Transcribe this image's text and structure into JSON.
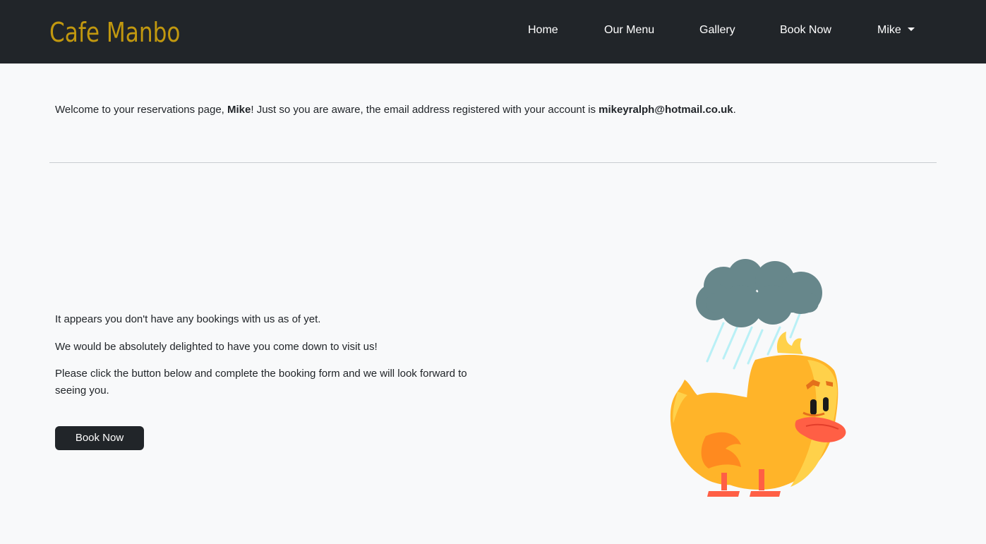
{
  "navbar": {
    "brand": "Cafe Manbo",
    "links": [
      "Home",
      "Our Menu",
      "Gallery",
      "Book Now"
    ],
    "user_menu": "Mike"
  },
  "welcome": {
    "prefix": "Welcome to your reservations page, ",
    "username": "Mike",
    "middle": "! Just so you are aware, the email address registered with your account is ",
    "email": "mikeyralph@hotmail.co.uk",
    "suffix": "."
  },
  "empty_state": {
    "line1": "It appears you don't have any bookings with us as of yet.",
    "line2": "We would be absolutely delighted to have you come down to visit us!",
    "line3": "Please click the button below and complete the booking form and we will look forward to seeing you.",
    "button_label": "Book Now",
    "illustration": "sad-duck-rain-cloud-icon"
  },
  "colors": {
    "navbar_bg": "#212529",
    "brand": "#c1980f",
    "page_bg": "#f8f9fa",
    "button_bg": "#212529"
  }
}
